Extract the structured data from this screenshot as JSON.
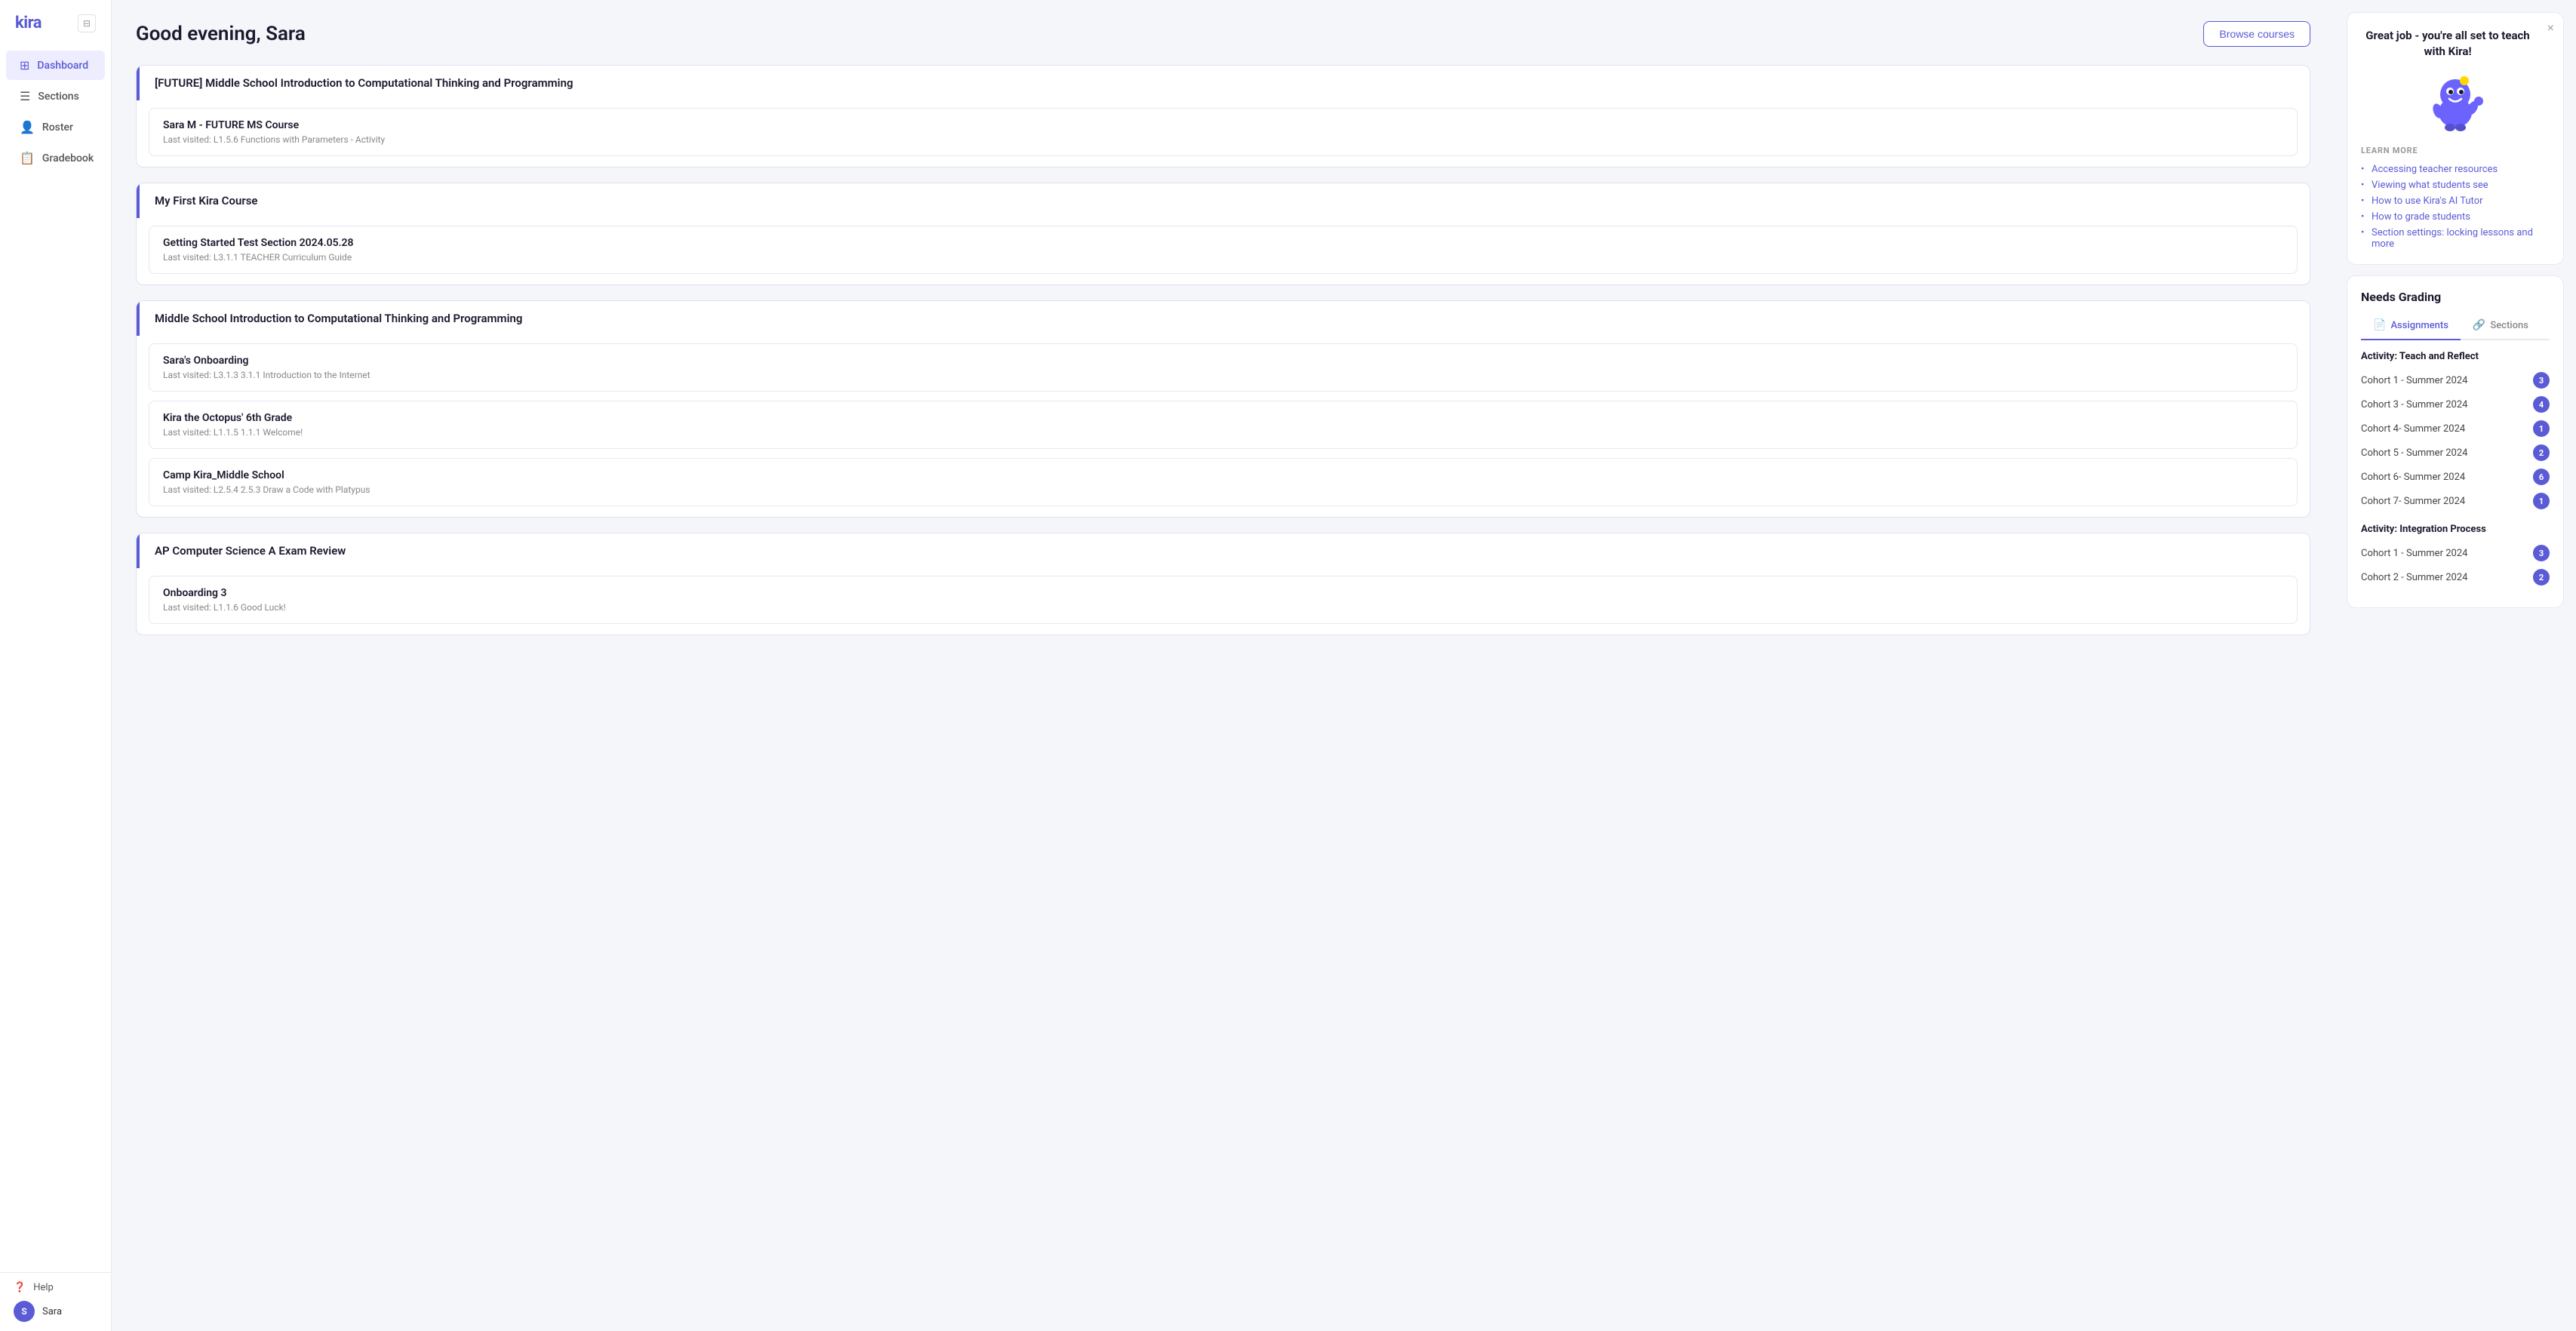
{
  "app": {
    "logo": "kira",
    "collapse_label": "⊟"
  },
  "sidebar": {
    "nav_items": [
      {
        "id": "dashboard",
        "label": "Dashboard",
        "icon": "⊞",
        "active": true
      },
      {
        "id": "sections",
        "label": "Sections",
        "icon": "☰"
      },
      {
        "id": "roster",
        "label": "Roster",
        "icon": "👤"
      },
      {
        "id": "gradebook",
        "label": "Gradebook",
        "icon": "📋"
      }
    ],
    "help_label": "Help",
    "user_label": "Sara",
    "user_initial": "S"
  },
  "header": {
    "greeting": "Good evening, Sara",
    "browse_label": "Browse courses"
  },
  "courses": [
    {
      "id": "future-ms",
      "title": "[FUTURE] Middle School Introduction to Computational Thinking and Programming",
      "sections": [
        {
          "name": "Sara M - FUTURE MS Course",
          "last_visited": "Last visited: L1.5.6 Functions with Parameters - Activity"
        }
      ]
    },
    {
      "id": "my-first-kira",
      "title": "My First Kira Course",
      "sections": [
        {
          "name": "Getting Started Test Section 2024.05.28",
          "last_visited": "Last visited: L3.1.1 TEACHER Curriculum Guide"
        }
      ]
    },
    {
      "id": "ms-intro",
      "title": "Middle School Introduction to Computational Thinking and Programming",
      "sections": [
        {
          "name": "Sara's Onboarding",
          "last_visited": "Last visited: L3.1.3 3.1.1 Introduction to the Internet"
        },
        {
          "name": "Kira the Octopus' 6th Grade",
          "last_visited": "Last visited: L1.1.5 1.1.1 Welcome!"
        },
        {
          "name": "Camp Kira_Middle School",
          "last_visited": "Last visited: L2.5.4 2.5.3 Draw a Code with Platypus"
        }
      ]
    },
    {
      "id": "ap-cs",
      "title": "AP Computer Science A Exam Review",
      "sections": [
        {
          "name": "Onboarding 3",
          "last_visited": "Last visited: L1.1.6 Good Luck!"
        }
      ]
    }
  ],
  "welcome_card": {
    "title": "Great job - you're all set to teach with Kira!",
    "close_label": "×",
    "learn_more_label": "LEARN MORE",
    "links": [
      "Accessing teacher resources",
      "Viewing what students see",
      "How to use Kira's AI Tutor",
      "How to grade students",
      "Section settings: locking lessons and more"
    ]
  },
  "needs_grading": {
    "title": "Needs Grading",
    "tabs": [
      {
        "id": "assignments",
        "label": "Assignments",
        "icon": "📄",
        "active": true
      },
      {
        "id": "sections",
        "label": "Sections",
        "icon": "🔗"
      }
    ],
    "activity_groups": [
      {
        "label": "Activity: Teach and Reflect",
        "rows": [
          {
            "cohort": "Cohort 1 - Summer 2024",
            "count": 3
          },
          {
            "cohort": "Cohort 3 - Summer 2024",
            "count": 4
          },
          {
            "cohort": "Cohort 4- Summer 2024",
            "count": 1
          },
          {
            "cohort": "Cohort 5 - Summer 2024",
            "count": 2
          },
          {
            "cohort": "Cohort 6- Summer 2024",
            "count": 6
          },
          {
            "cohort": "Cohort 7- Summer 2024",
            "count": 1
          }
        ]
      },
      {
        "label": "Activity: Integration Process",
        "rows": [
          {
            "cohort": "Cohort 1 - Summer 2024",
            "count": 3
          },
          {
            "cohort": "Cohort 2 - Summer 2024",
            "count": 2
          }
        ]
      }
    ]
  }
}
